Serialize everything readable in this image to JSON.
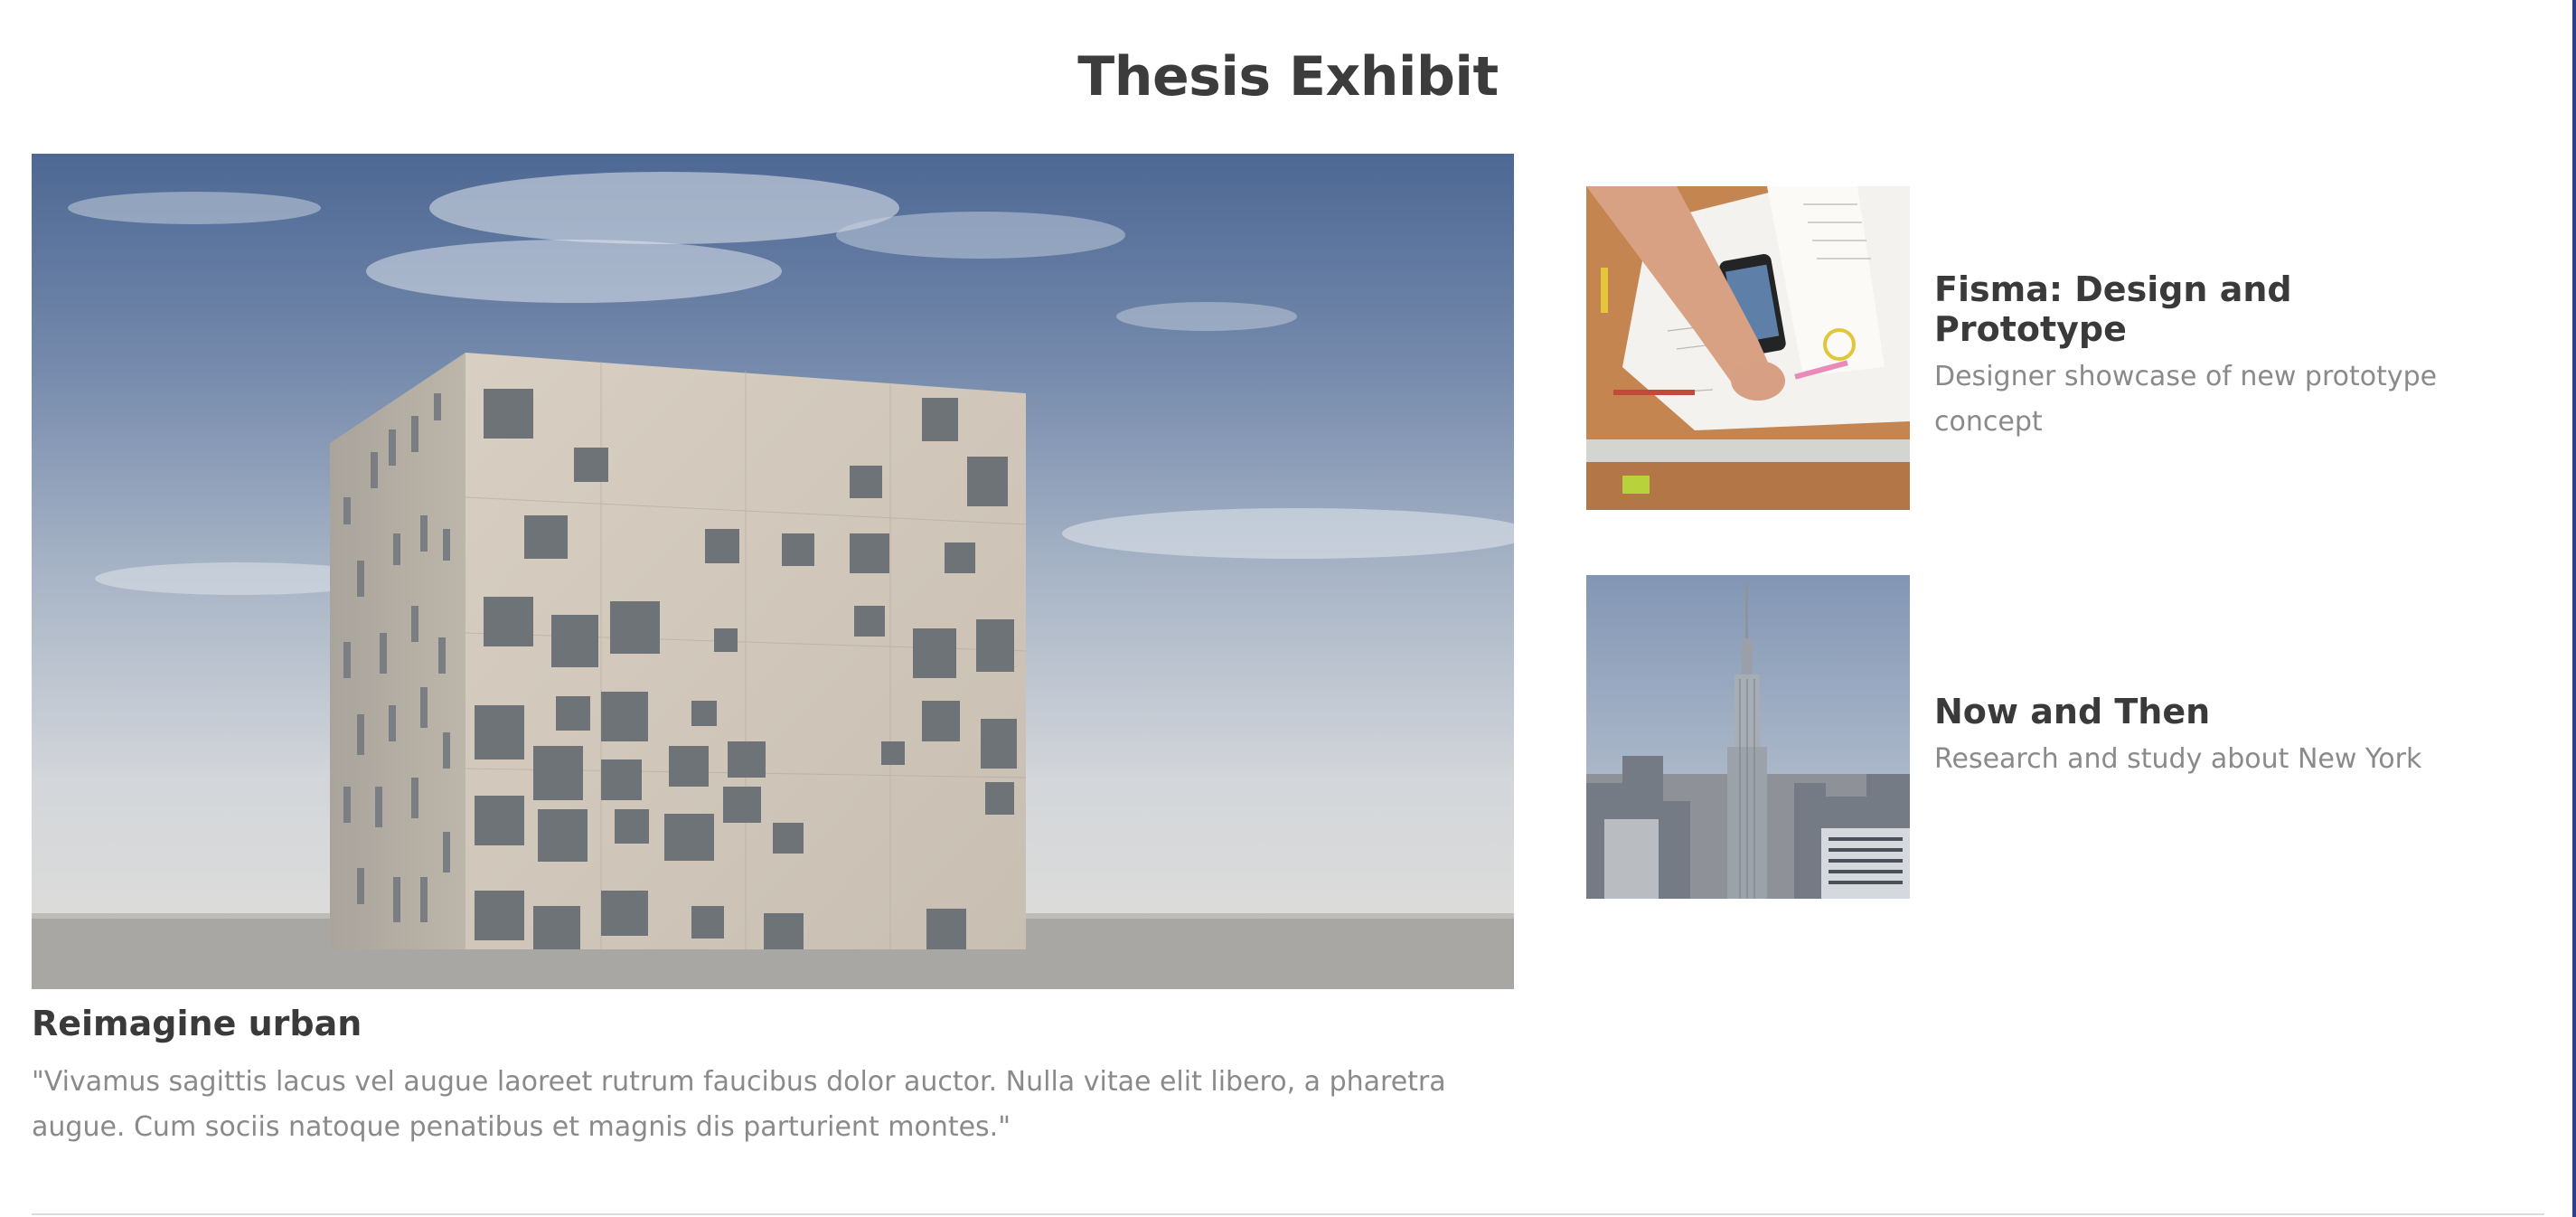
{
  "page": {
    "title": "Thesis Exhibit"
  },
  "featured": {
    "title": "Reimagine urban",
    "quote": "\"Vivamus sagittis lacus vel augue laoreet rutrum faucibus dolor auctor. Nulla vitae elit libero, a pharetra augue. Cum sociis natoque penatibus et magnis dis parturient montes.\""
  },
  "side_items": [
    {
      "title": "Fisma: Design and Prototype",
      "description": "Designer showcase of new prototype concept"
    },
    {
      "title": "Now and Then",
      "description": "Research and study about New York"
    }
  ],
  "colors": {
    "heading": "#3c3c3c",
    "body_text": "#8a8a8a",
    "edge_accent": "#2c3f8a"
  }
}
